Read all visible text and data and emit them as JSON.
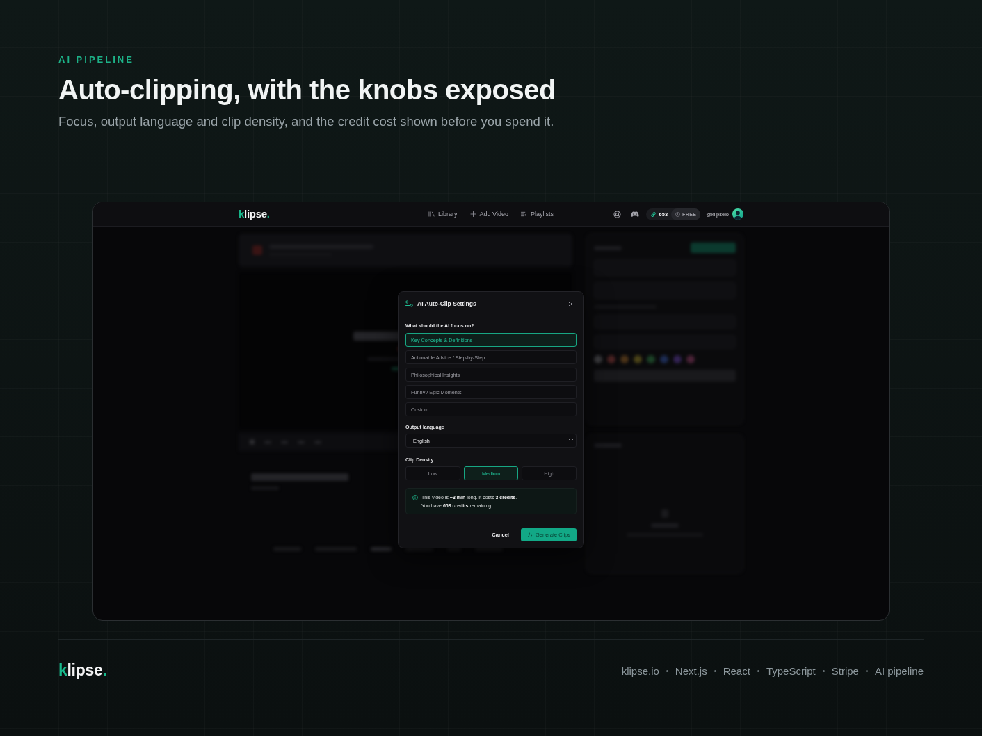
{
  "header": {
    "eyebrow": "AI PIPELINE",
    "title": "Auto-clipping, with the knobs exposed",
    "subtitle": "Focus, output language and clip density, and the credit cost shown before you spend it."
  },
  "app": {
    "nav": {
      "logo": "klipse.",
      "links": [
        {
          "label": "Library"
        },
        {
          "label": "Add Video"
        },
        {
          "label": "Playlists"
        }
      ],
      "credits": "653",
      "plan": "FREE",
      "handle": "@klipseio"
    },
    "dialog": {
      "title": "AI Auto-Clip Settings",
      "focus_label": "What should the AI focus on?",
      "focus_options": [
        {
          "label": "Key Concepts & Definitions",
          "selected": true
        },
        {
          "label": "Actionable Advice / Step-by-Step",
          "selected": false
        },
        {
          "label": "Philosophical Insights",
          "selected": false
        },
        {
          "label": "Funny / Epic Moments",
          "selected": false
        },
        {
          "label": "Custom",
          "selected": false
        }
      ],
      "language_label": "Output language",
      "language": "English",
      "density_label": "Clip Density",
      "density_options": [
        {
          "label": "Low",
          "selected": false
        },
        {
          "label": "Medium",
          "selected": true
        },
        {
          "label": "High",
          "selected": false
        }
      ],
      "notice": [
        "This video is **~3 min** long. It costs **3 credits**.",
        "You have **653 credits** remaining."
      ],
      "buttons": [
        {
          "label": "Cancel",
          "kind": "secondary"
        },
        {
          "label": "Generate Clips",
          "kind": "primary"
        }
      ]
    }
  },
  "footer": {
    "logo": "klipse.",
    "links": [
      "klipse.io",
      "Next.js",
      "React",
      "TypeScript",
      "Stripe",
      "AI pipeline"
    ]
  }
}
